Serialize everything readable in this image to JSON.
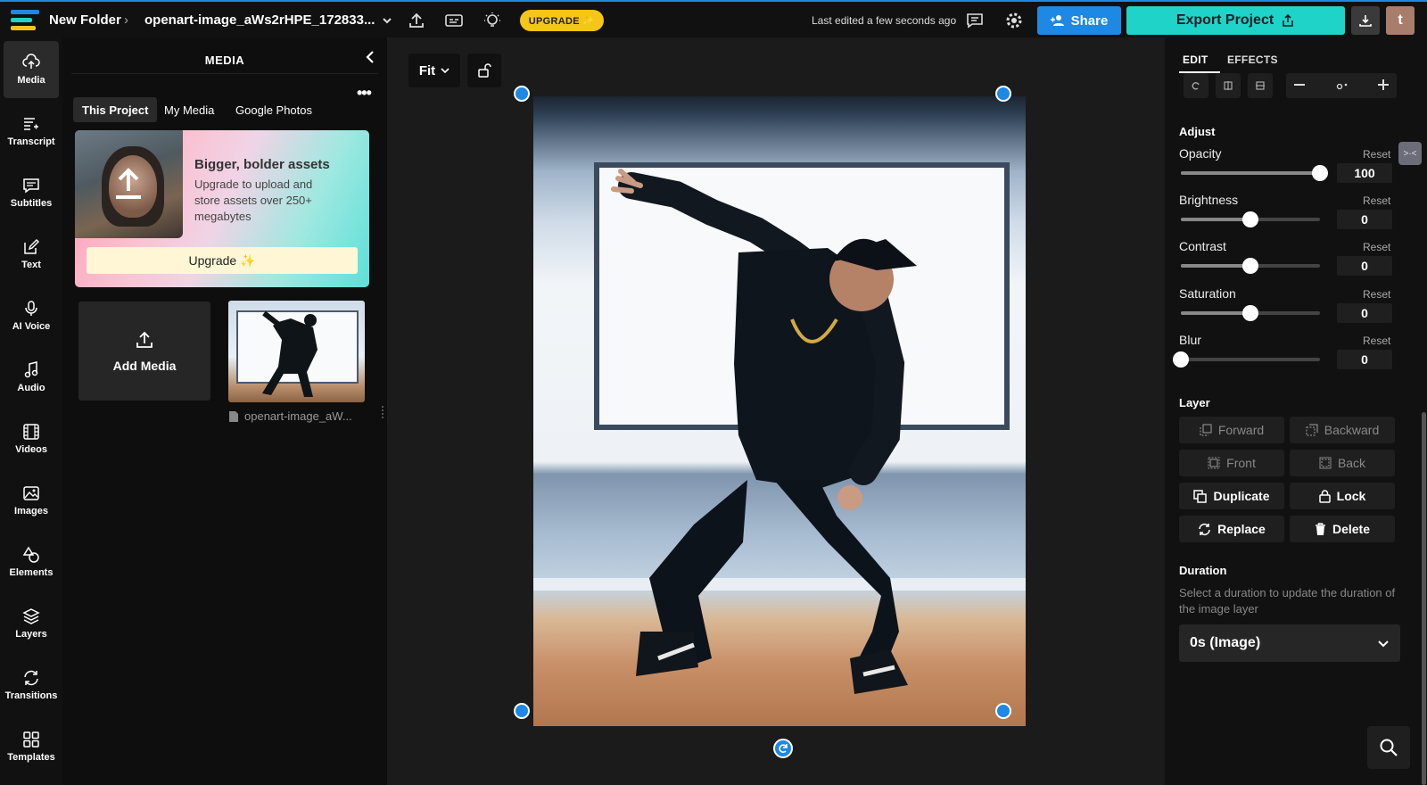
{
  "header": {
    "folder": "New Folder",
    "project_name": "openart-image_aWs2rHPE_172833...",
    "upgrade_label": "UPGRADE ✨",
    "last_edited": "Last edited a few seconds ago",
    "share_label": "Share",
    "export_label": "Export Project",
    "avatar_letter": "t"
  },
  "rail": {
    "items": [
      {
        "label": "Media",
        "icon": "upload-cloud-icon"
      },
      {
        "label": "Transcript",
        "icon": "transcript-icon"
      },
      {
        "label": "Subtitles",
        "icon": "subtitles-icon"
      },
      {
        "label": "Text",
        "icon": "text-edit-icon"
      },
      {
        "label": "AI Voice",
        "icon": "microphone-icon"
      },
      {
        "label": "Audio",
        "icon": "music-note-icon"
      },
      {
        "label": "Videos",
        "icon": "film-icon"
      },
      {
        "label": "Images",
        "icon": "image-icon"
      },
      {
        "label": "Elements",
        "icon": "shapes-icon"
      },
      {
        "label": "Layers",
        "icon": "layers-icon"
      },
      {
        "label": "Transitions",
        "icon": "transitions-icon"
      },
      {
        "label": "Templates",
        "icon": "grid-icon"
      }
    ]
  },
  "media_panel": {
    "title": "MEDIA",
    "tabs": [
      "This Project",
      "My Media",
      "Google Photos"
    ],
    "promo": {
      "title": "Bigger, bolder assets",
      "text": "Upgrade to upload and store assets over 250+ megabytes",
      "button": "Upgrade ✨"
    },
    "add_media_label": "Add Media",
    "file_name": "openart-image_aW..."
  },
  "canvas": {
    "fit_label": "Fit"
  },
  "edit_panel": {
    "tabs": [
      "EDIT",
      "EFFECTS"
    ],
    "adjust_title": "Adjust",
    "reset_label": "Reset",
    "adjust": [
      {
        "label": "Opacity",
        "value": "100",
        "fraction": 1.0
      },
      {
        "label": "Brightness",
        "value": "0",
        "fraction": 0.5
      },
      {
        "label": "Contrast",
        "value": "0",
        "fraction": 0.5
      },
      {
        "label": "Saturation",
        "value": "0",
        "fraction": 0.5
      },
      {
        "label": "Blur",
        "value": "0",
        "fraction": 0.0
      }
    ],
    "layer_title": "Layer",
    "layer_buttons": [
      {
        "label": "Forward",
        "icon": "bring-forward-icon",
        "enabled": false
      },
      {
        "label": "Backward",
        "icon": "send-backward-icon",
        "enabled": false
      },
      {
        "label": "Front",
        "icon": "bring-front-icon",
        "enabled": false
      },
      {
        "label": "Back",
        "icon": "send-back-icon",
        "enabled": false
      },
      {
        "label": "Duplicate",
        "icon": "duplicate-icon",
        "enabled": true
      },
      {
        "label": "Lock",
        "icon": "lock-icon",
        "enabled": true
      },
      {
        "label": "Replace",
        "icon": "replace-icon",
        "enabled": true
      },
      {
        "label": "Delete",
        "icon": "trash-icon",
        "enabled": true
      }
    ],
    "duration_title": "Duration",
    "duration_help": "Select a duration to update the duration of the image layer",
    "duration_value": "0s (Image)"
  },
  "colors": {
    "accent_blue": "#1e88e5",
    "export_teal": "#20d3c9",
    "upgrade_yellow": "#f5c518"
  }
}
